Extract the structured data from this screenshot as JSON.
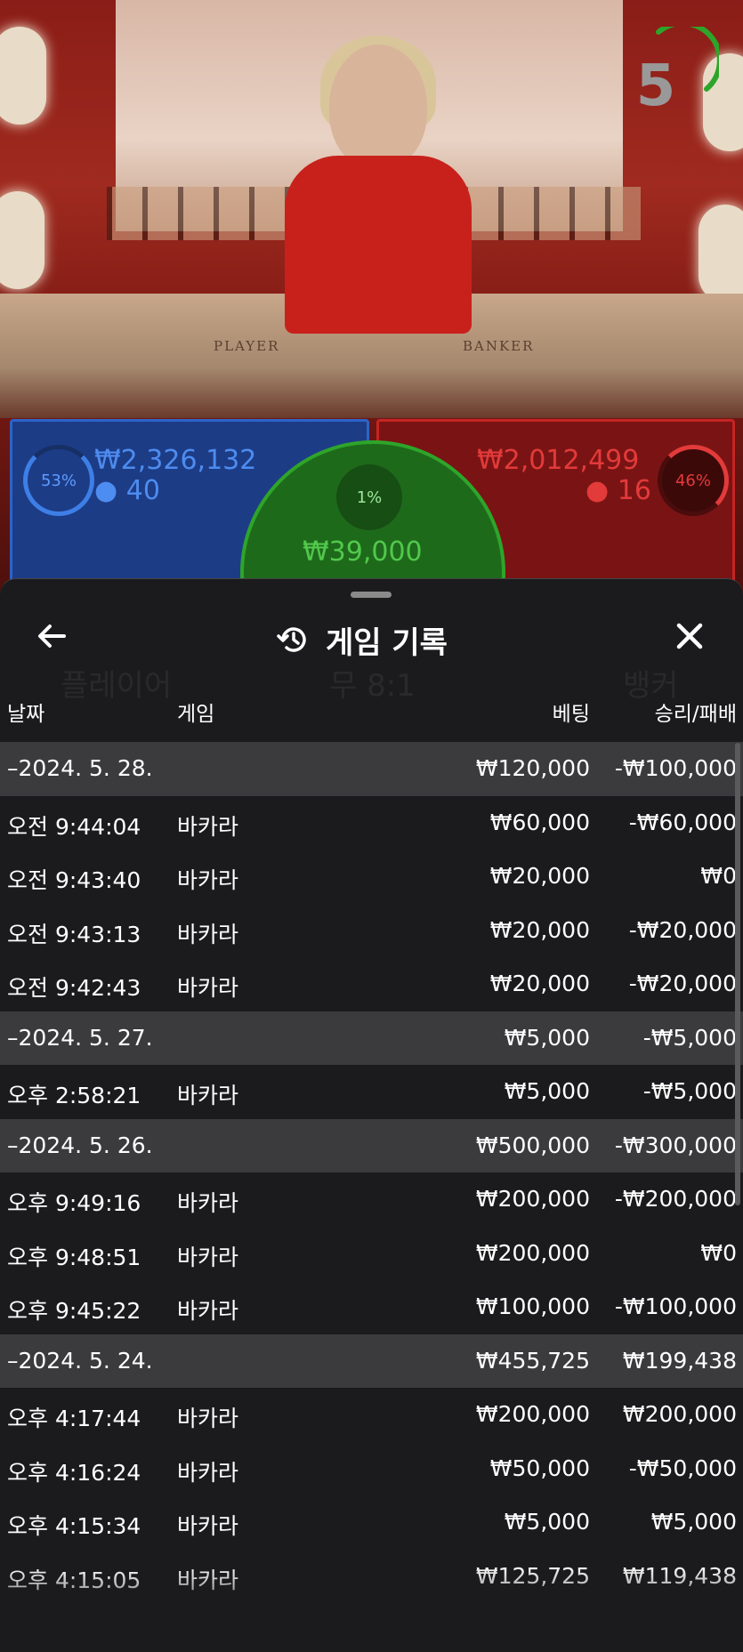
{
  "stream": {
    "countdown": "5",
    "table_labels": {
      "player": "PLAYER",
      "banker": "BANKER"
    }
  },
  "bets_overview": {
    "player": {
      "percent": "53%",
      "amount": "₩2,326,132",
      "count": "40",
      "color": "#2d63c7"
    },
    "banker": {
      "percent": "46%",
      "amount": "₩2,012,499",
      "count": "16",
      "color": "#c62424"
    },
    "tie": {
      "percent": "1%",
      "amount": "₩39,000",
      "color": "#2ea52a"
    }
  },
  "history": {
    "title": "게임 기록",
    "icons": {
      "back": "back-arrow-icon",
      "history": "history-icon",
      "close": "close-icon"
    },
    "columns": {
      "date": "날짜",
      "game": "게임",
      "bet": "베팅",
      "win_loss": "승리/패배"
    },
    "rows": [
      {
        "type": "date",
        "label": "–2024. 5. 28.",
        "bet": "₩120,000",
        "wl": "-₩100,000"
      },
      {
        "type": "item",
        "time": "오전 9:44:04",
        "game": "바카라",
        "bet": "₩60,000",
        "wl": "-₩60,000"
      },
      {
        "type": "item",
        "time": "오전 9:43:40",
        "game": "바카라",
        "bet": "₩20,000",
        "wl": "₩0"
      },
      {
        "type": "item",
        "time": "오전 9:43:13",
        "game": "바카라",
        "bet": "₩20,000",
        "wl": "-₩20,000"
      },
      {
        "type": "item",
        "time": "오전 9:42:43",
        "game": "바카라",
        "bet": "₩20,000",
        "wl": "-₩20,000"
      },
      {
        "type": "date",
        "label": "–2024. 5. 27.",
        "bet": "₩5,000",
        "wl": "-₩5,000"
      },
      {
        "type": "item",
        "time": "오후 2:58:21",
        "game": "바카라",
        "bet": "₩5,000",
        "wl": "-₩5,000"
      },
      {
        "type": "date",
        "label": "–2024. 5. 26.",
        "bet": "₩500,000",
        "wl": "-₩300,000"
      },
      {
        "type": "item",
        "time": "오후 9:49:16",
        "game": "바카라",
        "bet": "₩200,000",
        "wl": "-₩200,000"
      },
      {
        "type": "item",
        "time": "오후 9:48:51",
        "game": "바카라",
        "bet": "₩200,000",
        "wl": "₩0"
      },
      {
        "type": "item",
        "time": "오후 9:45:22",
        "game": "바카라",
        "bet": "₩100,000",
        "wl": "-₩100,000"
      },
      {
        "type": "date",
        "label": "–2024. 5. 24.",
        "bet": "₩455,725",
        "wl": "₩199,438"
      },
      {
        "type": "item",
        "time": "오후 4:17:44",
        "game": "바카라",
        "bet": "₩200,000",
        "wl": "₩200,000"
      },
      {
        "type": "item",
        "time": "오후 4:16:24",
        "game": "바카라",
        "bet": "₩50,000",
        "wl": "-₩50,000"
      },
      {
        "type": "item",
        "time": "오후 4:15:34",
        "game": "바카라",
        "bet": "₩5,000",
        "wl": "₩5,000"
      },
      {
        "type": "item",
        "time": "오후 4:15:05",
        "game": "바카라",
        "bet": "₩125,725",
        "wl": "₩119,438"
      }
    ]
  },
  "background_ui": {
    "player_title": "플레이어",
    "tie_title": "무 8:1",
    "banker_title": "뱅커"
  }
}
